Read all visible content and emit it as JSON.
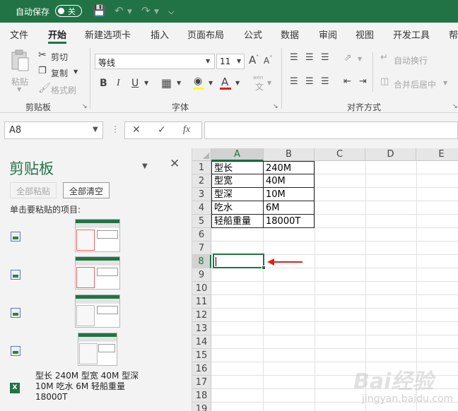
{
  "titlebar": {
    "autosave_label": "自动保存",
    "autosave_state": "关"
  },
  "tabs": [
    "文件",
    "开始",
    "新建选项卡",
    "插入",
    "页面布局",
    "公式",
    "数据",
    "审阅",
    "视图",
    "开发工具",
    "帮"
  ],
  "ribbon": {
    "clipboard": {
      "paste": "粘贴",
      "cut": "剪切",
      "copy": "复制",
      "format_painter": "格式刷",
      "label": "剪贴板"
    },
    "font": {
      "font_name": "等线",
      "font_size": "11",
      "label": "字体",
      "bold": "B",
      "italic": "I",
      "underline": "U",
      "wen": "wén",
      "wen_char": "文"
    },
    "alignment": {
      "wrap": "自动换行",
      "merge": "合并后居中",
      "label": "对齐方式"
    }
  },
  "formula_bar": {
    "name_box": "A8",
    "formula": ""
  },
  "clipboard_pane": {
    "title": "剪贴板",
    "paste_all": "全部粘贴",
    "clear_all": "全部清空",
    "instruction": "单击要粘贴的项目:",
    "text_item": "型长 240M 型宽 40M 型深 10M 吃水 6M 轻船重量 18000T"
  },
  "sheet": {
    "columns": [
      "A",
      "B",
      "C",
      "D",
      "E"
    ],
    "rows": [
      "1",
      "2",
      "3",
      "4",
      "5",
      "6",
      "7",
      "8",
      "9",
      "10",
      "11",
      "12",
      "13",
      "14",
      "15",
      "16",
      "17",
      "18",
      "19"
    ],
    "data": [
      [
        "型长",
        "240M"
      ],
      [
        "型宽",
        "40M"
      ],
      [
        "型深",
        "10M"
      ],
      [
        "吃水",
        "6M"
      ],
      [
        "轻船重量",
        "18000T"
      ]
    ]
  },
  "watermark": {
    "text": "Bai经验",
    "sub": "jingyan.baidu.com"
  },
  "colors": {
    "accent": "#217346",
    "arrow": "#e02020"
  }
}
